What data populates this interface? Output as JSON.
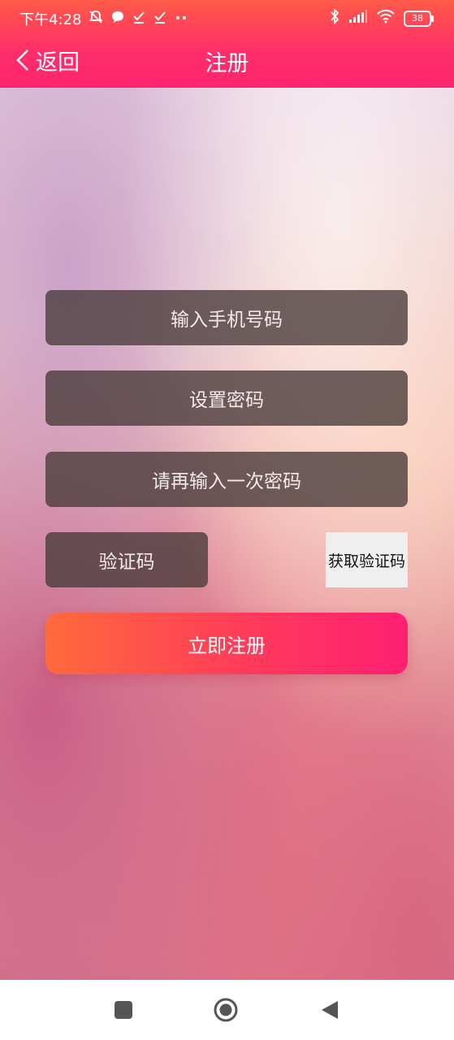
{
  "status_bar": {
    "time": "下午4:28",
    "battery": "38"
  },
  "header": {
    "back_label": "返回",
    "title": "注册"
  },
  "form": {
    "phone_placeholder": "输入手机号码",
    "password_placeholder": "设置密码",
    "confirm_password_placeholder": "请再输入一次密码",
    "code_placeholder": "验证码",
    "get_code_label": "获取验证码",
    "submit_label": "立即注册"
  },
  "colors": {
    "header_top": "#ff5a47",
    "header_bottom": "#ff2470",
    "button_start": "#ff6a3c",
    "button_end": "#ff1f72"
  }
}
